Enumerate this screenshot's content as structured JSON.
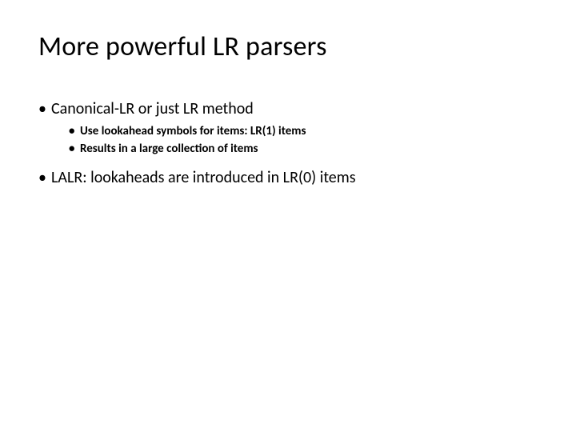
{
  "title": "More powerful LR parsers",
  "bullets": [
    {
      "text": "Canonical-LR or just LR method",
      "children": [
        {
          "text": "Use lookahead symbols for items: LR(1) items"
        },
        {
          "text": "Results in a large collection of items"
        }
      ]
    },
    {
      "text": "LALR: lookaheads are introduced in LR(0) items",
      "children": []
    }
  ]
}
